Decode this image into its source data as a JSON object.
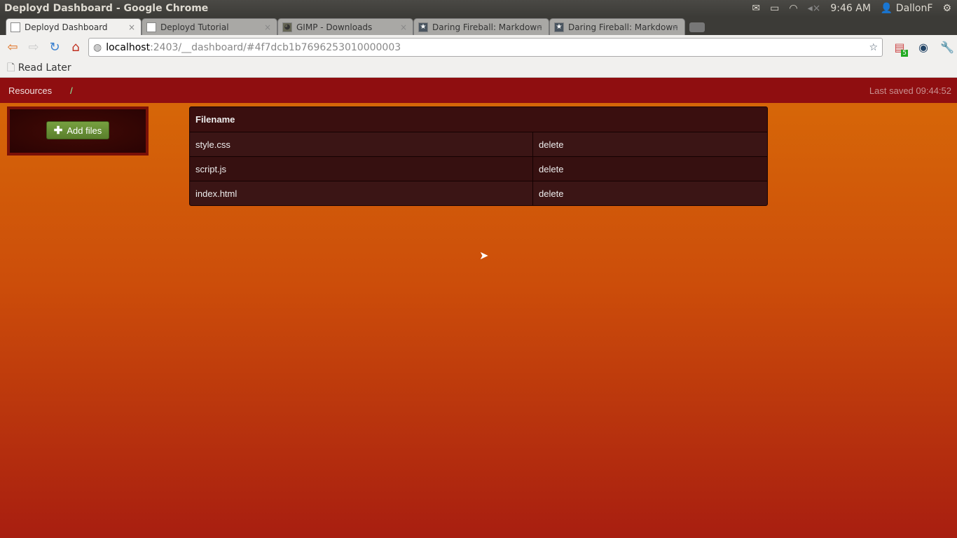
{
  "window": {
    "title": "Deployd Dashboard - Google Chrome"
  },
  "tray": {
    "time": "9:46 AM",
    "user": "DallonF"
  },
  "tabs": [
    {
      "label": "Deployd Dashboard",
      "icon": "page-icon",
      "active": true
    },
    {
      "label": "Deployd Tutorial",
      "icon": "page-icon"
    },
    {
      "label": "GIMP - Downloads",
      "icon": "gimp-icon"
    },
    {
      "label": "Daring Fireball: Markdown",
      "icon": "star-icon"
    },
    {
      "label": "Daring Fireball: Markdown",
      "icon": "star-icon"
    }
  ],
  "omnibox": {
    "host": "localhost",
    "rest": ":2403/__dashboard/#4f7dcb1b7696253010000003"
  },
  "extension_badge": "5",
  "bookmarks": [
    {
      "label": "Read Later"
    }
  ],
  "app": {
    "nav": {
      "resources": "Resources",
      "separator": "/",
      "last_saved": "Last saved 09:44:52"
    },
    "add_files": "Add files",
    "table": {
      "header": "Filename",
      "rows": [
        {
          "filename": "style.css",
          "action": "delete"
        },
        {
          "filename": "script.js",
          "action": "delete"
        },
        {
          "filename": "index.html",
          "action": "delete"
        }
      ]
    }
  }
}
